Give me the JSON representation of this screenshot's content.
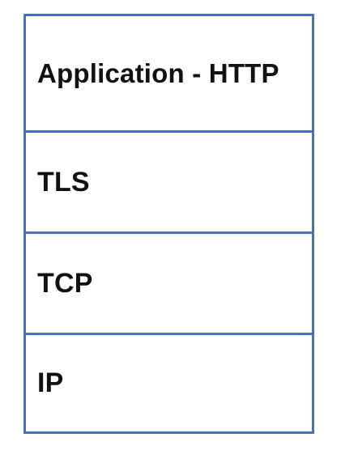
{
  "diagram": {
    "border_color": "#4a72b8",
    "layers": [
      {
        "label": "Application - HTTP"
      },
      {
        "label": "TLS"
      },
      {
        "label": "TCP"
      },
      {
        "label": "IP"
      }
    ]
  }
}
